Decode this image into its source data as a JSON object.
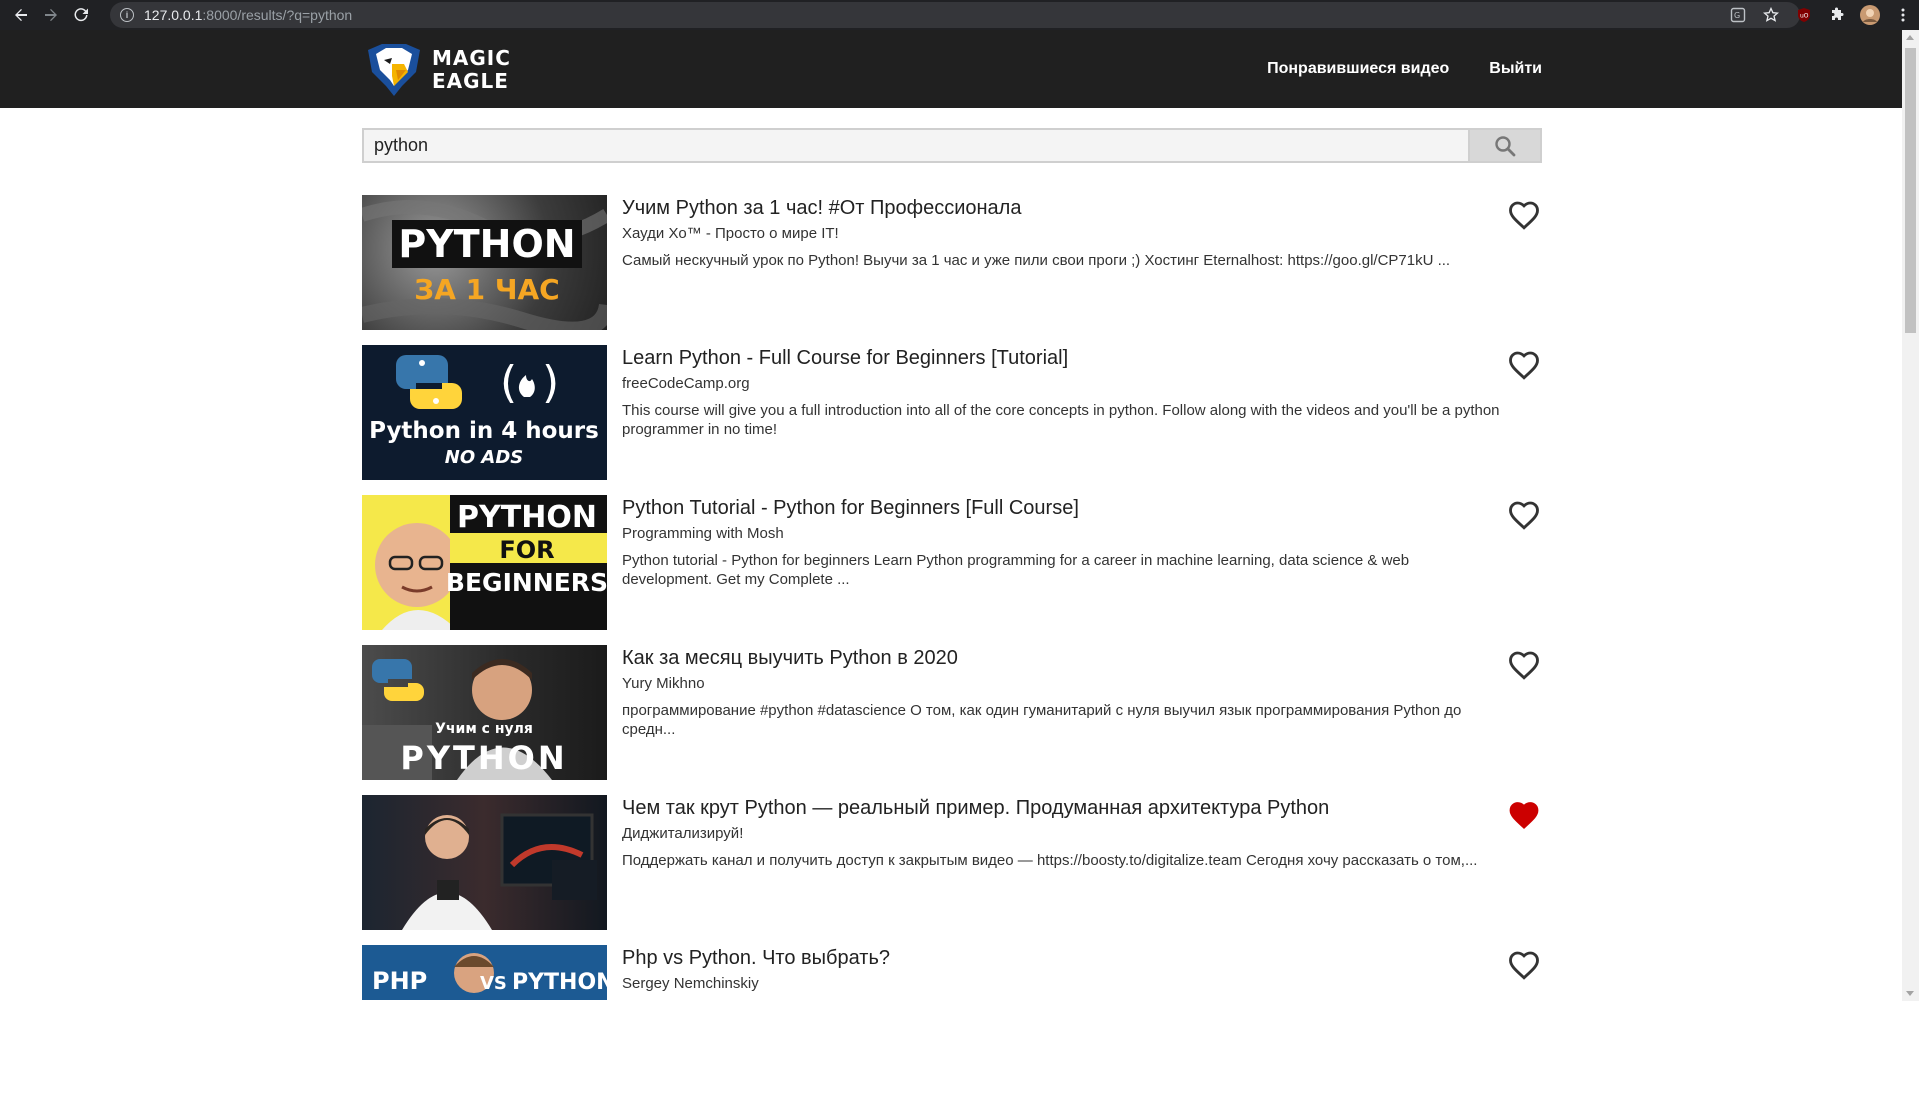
{
  "browser": {
    "url_host": "127.0.0.1",
    "url_rest": ":8000/results/?q=python"
  },
  "header": {
    "logo_line1": "MAGIC",
    "logo_line2": "EAGLE",
    "liked_videos_label": "Понравившиеся видео",
    "logout_label": "Выйти"
  },
  "search": {
    "value": "python"
  },
  "results": [
    {
      "title": "Учим Python за 1 час! #От Профессионала",
      "channel": "Хауди Хо™ - Просто о мире IT!",
      "description": "Самый нескучный урок по Python! Выучи за 1 час и уже пили свои проги ;) Хостинг Eternalhost: https://goo.gl/CP71kU ...",
      "liked": false,
      "thumb_text1": "PYTHON",
      "thumb_text2": "ЗА 1 ЧАС"
    },
    {
      "title": "Learn Python - Full Course for Beginners [Tutorial]",
      "channel": "freeCodeCamp.org",
      "description": "This course will give you a full introduction into all of the core concepts in python. Follow along with the videos and you'll be a python programmer in no time!",
      "liked": false,
      "thumb_text1": "Python in 4 hours",
      "thumb_text2": "NO ADS"
    },
    {
      "title": "Python Tutorial - Python for Beginners [Full Course]",
      "channel": "Programming with Mosh",
      "description": "Python tutorial - Python for beginners Learn Python programming for a career in machine learning, data science & web development. Get my Complete ...",
      "liked": false,
      "thumb_text1": "PYTHON",
      "thumb_text2": "FOR",
      "thumb_text3": "BEGINNERS"
    },
    {
      "title": "Как за месяц выучить Python в 2020",
      "channel": "Yury Mikhno",
      "description": "программирование #python #datascience О том, как один гуманитарий с нуля выучил язык программирования Python до средн...",
      "liked": false,
      "thumb_text1": "Учим с нуля",
      "thumb_text2": "PYTHON"
    },
    {
      "title": "Чем так крут Python — реальный пример. Продуманная архитектура Python",
      "channel": "Диджитализируй!",
      "description": "Поддержать канал и получить доступ к закрытым видео — https://boosty.to/digitalize.team Сегодня хочу рассказать о том,...",
      "liked": true
    },
    {
      "title": "Php vs Python. Что выбрать?",
      "channel": "Sergey Nemchinskiy",
      "description": "",
      "liked": false,
      "thumb_text1": "PHP",
      "thumb_text2": "VS",
      "thumb_text3": "PYTHON"
    }
  ],
  "colors": {
    "header_bg": "#202020",
    "liked_heart": "#cc0000",
    "unliked_heart": "#333333"
  }
}
